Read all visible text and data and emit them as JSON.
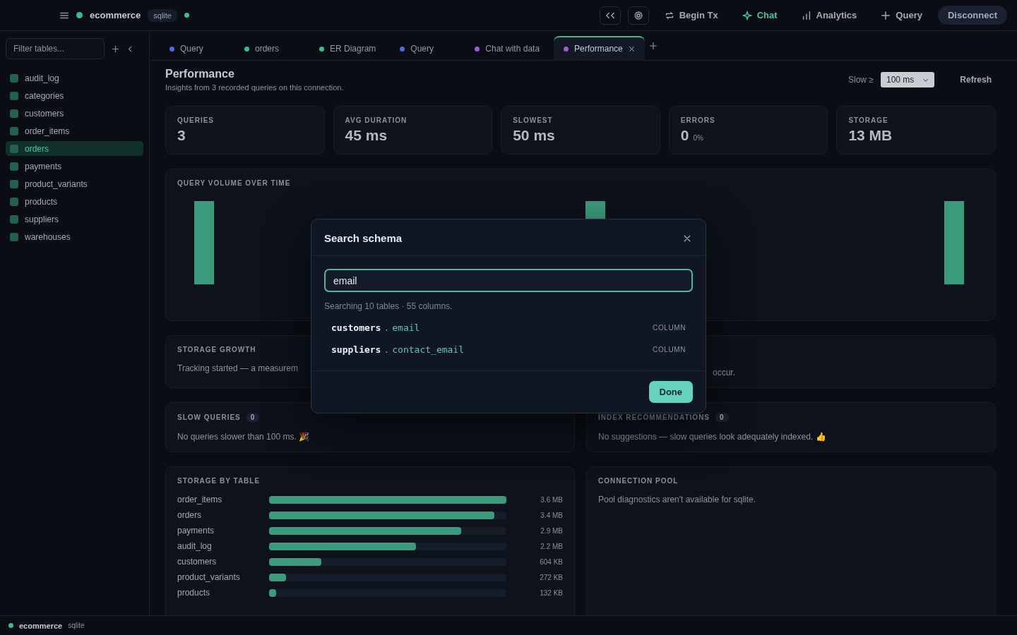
{
  "topbar": {
    "connection": "ecommerce",
    "engine": "sqlite",
    "actions": [
      {
        "kind": "icon"
      },
      {
        "kind": "icon"
      },
      {
        "kind": "text",
        "label": "Begin Tx",
        "selected": false
      },
      {
        "kind": "text",
        "label": "Chat",
        "selected": true
      },
      {
        "kind": "text",
        "label": "Analytics",
        "selected": false
      },
      {
        "kind": "text",
        "label": "Query",
        "selected": false
      },
      {
        "kind": "pill",
        "label": "Disconnect"
      }
    ]
  },
  "sidebar": {
    "filter_placeholder": "Filter tables...",
    "tables": [
      {
        "name": "audit_log",
        "selected": false
      },
      {
        "name": "categories",
        "selected": false
      },
      {
        "name": "customers",
        "selected": false
      },
      {
        "name": "order_items",
        "selected": false
      },
      {
        "name": "orders",
        "selected": true
      },
      {
        "name": "payments",
        "selected": false
      },
      {
        "name": "product_variants",
        "selected": false
      },
      {
        "name": "products",
        "selected": false
      },
      {
        "name": "suppliers",
        "selected": false
      },
      {
        "name": "warehouses",
        "selected": false
      }
    ]
  },
  "tabs": [
    {
      "label": "Query",
      "color": "#4f6fd0",
      "selected": false
    },
    {
      "label": "orders",
      "color": "#3fb98f",
      "selected": false
    },
    {
      "label": "ER Diagram",
      "color": "#3fb98f",
      "selected": false
    },
    {
      "label": "Query",
      "color": "#4f6fd0",
      "selected": false
    },
    {
      "label": "Chat with data",
      "color": "#9a5fd0",
      "selected": false
    },
    {
      "label": "Performance",
      "color": "#9a5fd0",
      "selected": true
    }
  ],
  "header": {
    "title": "Performance",
    "subtitle": "Insights from 3 recorded queries on this connection.",
    "slow_label": "Slow ≥",
    "slow_value": "100 ms",
    "refresh": "Refresh"
  },
  "stats": [
    {
      "label": "QUERIES",
      "value": "3"
    },
    {
      "label": "AVG DURATION",
      "value": "45 ms"
    },
    {
      "label": "SLOWEST",
      "value": "50 ms"
    },
    {
      "label": "ERRORS",
      "value": "0",
      "note": "0%"
    },
    {
      "label": "STORAGE",
      "value": "13 MB"
    }
  ],
  "volume": {
    "title": "QUERY VOLUME OVER TIME"
  },
  "growth": {
    "title": "STORAGE GROWTH",
    "text": "Tracking started — a measurem"
  },
  "growth_right": {
    "text": "occur."
  },
  "slow_queries": {
    "title": "SLOW QUERIES",
    "count": "0",
    "text": "No queries slower than 100 ms. 🎉"
  },
  "index_recs": {
    "title": "INDEX RECOMMENDATIONS",
    "count": "0",
    "text": "No suggestions — slow queries look adequately indexed. 👍"
  },
  "storage": {
    "title": "STORAGE BY TABLE",
    "rows": [
      {
        "name": "order_items",
        "level": 1,
        "size": "3.6 MB"
      },
      {
        "name": "orders",
        "level": 0.95,
        "size": "3.4 MB"
      },
      {
        "name": "payments",
        "level": 0.81,
        "size": "2.9 MB"
      },
      {
        "name": "audit_log",
        "level": 0.62,
        "size": "2.2 MB"
      },
      {
        "name": "customers",
        "level": 0.22,
        "size": "604 KB"
      },
      {
        "name": "product_variants",
        "level": 0.07,
        "size": "272 KB"
      },
      {
        "name": "products",
        "level": 0.03,
        "size": "132 KB"
      }
    ]
  },
  "pool": {
    "title": "CONNECTION POOL",
    "text": "Pool diagnostics aren't available for sqlite."
  },
  "status_bar": {
    "connection": "ecommerce",
    "engine": "sqlite"
  },
  "dialog": {
    "title": "Search schema",
    "query": "email",
    "summary": "Searching 10 tables · 55 columns.",
    "results": [
      {
        "table": "customers",
        "separator": ".",
        "column": "email",
        "type": "COLUMN"
      },
      {
        "table": "suppliers",
        "separator": ".",
        "column": "contact_email",
        "type": "COLUMN"
      }
    ],
    "done": "Done"
  }
}
